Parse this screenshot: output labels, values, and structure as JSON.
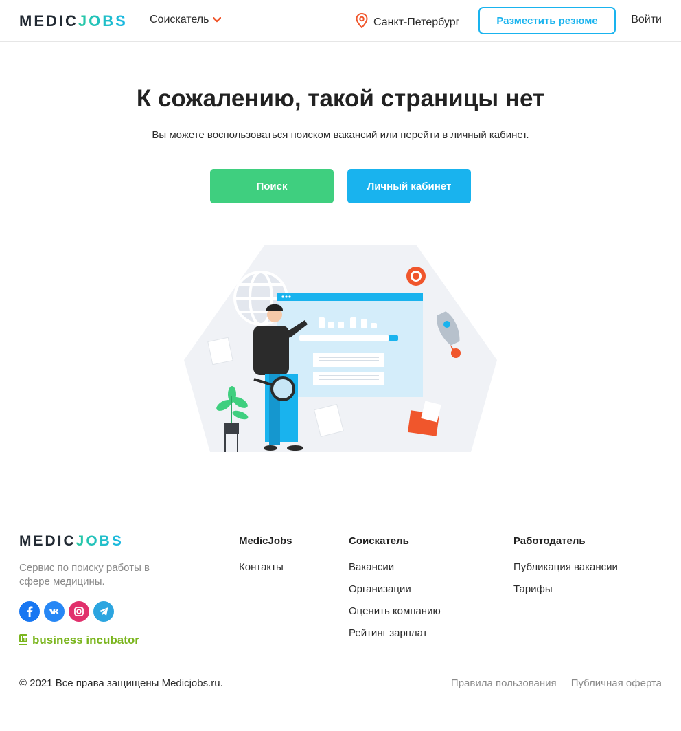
{
  "header": {
    "logo_medic": "MEDIC",
    "logo_jobs": "JOBS",
    "role_label": "Соискатель",
    "city": "Санкт-Петербург",
    "resume_button": "Разместить резюме",
    "login": "Войти"
  },
  "main": {
    "title": "К сожалению, такой страницы нет",
    "subtitle": "Вы можете воспользоваться поиском вакансий или перейти в личный кабинет.",
    "search_button": "Поиск",
    "cabinet_button": "Личный кабинет"
  },
  "footer": {
    "logo_medic": "MEDIC",
    "logo_jobs": "JOBS",
    "description": "Сервис по поиску работы в сфере медицины.",
    "incubator_label": "business incubator",
    "columns": [
      {
        "title": "MedicJobs",
        "links": [
          "Контакты"
        ]
      },
      {
        "title": "Соискатель",
        "links": [
          "Вакансии",
          "Организации",
          "Оценить компанию",
          "Рейтинг зарплат"
        ]
      },
      {
        "title": "Работодатель",
        "links": [
          "Публикация вакансии",
          "Тарифы"
        ]
      }
    ],
    "copyright": "© 2021 Все права защищены Medicjobs.ru.",
    "terms": "Правила пользования",
    "offer": "Публичная оферта"
  },
  "colors": {
    "accent_blue": "#19b3ee",
    "accent_green": "#3fcf7f",
    "accent_orange": "#f0562c",
    "facebook": "#1877f2",
    "vk": "#2787f5",
    "instagram": "#e1306c",
    "telegram": "#2ca5e0"
  },
  "icons": [
    "chevron-down-icon",
    "location-pin-icon",
    "facebook-icon",
    "vk-icon",
    "instagram-icon",
    "telegram-icon"
  ]
}
